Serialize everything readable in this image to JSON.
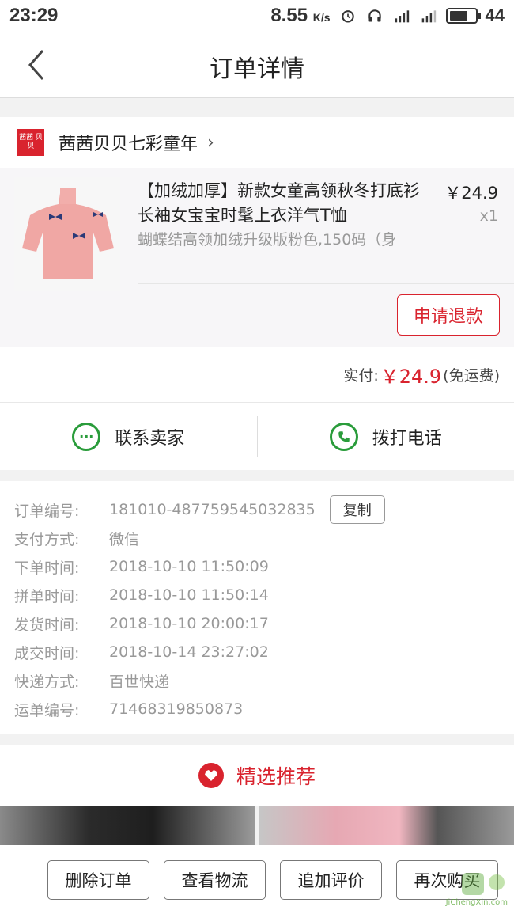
{
  "status": {
    "time": "23:29",
    "speed": "8.55",
    "speed_unit": "K/s",
    "net1": "3G",
    "net2": "4G",
    "battery": "44"
  },
  "nav": {
    "title": "订单详情"
  },
  "shop": {
    "logo_text": "茜茜 贝贝",
    "name": "茜茜贝贝七彩童年"
  },
  "product": {
    "title": "【加绒加厚】新款女童高领秋冬打底衫长袖女宝宝时髦上衣洋气T恤",
    "spec": "蝴蝶结高领加绒升级版粉色,150码（身",
    "price": "￥24.9",
    "qty": "x1",
    "refund_label": "申请退款"
  },
  "payment": {
    "label": "实付:",
    "amount": "￥24.9",
    "note": "(免运费)"
  },
  "contact": {
    "seller_label": "联系卖家",
    "call_label": "拨打电话"
  },
  "order_info": {
    "rows": [
      {
        "key": "订单编号:",
        "value": "181010-487759545032835"
      },
      {
        "key": "支付方式:",
        "value": "微信"
      },
      {
        "key": "下单时间:",
        "value": "2018-10-10 11:50:09"
      },
      {
        "key": "拼单时间:",
        "value": "2018-10-10 11:50:14"
      },
      {
        "key": "发货时间:",
        "value": "2018-10-10 20:00:17"
      },
      {
        "key": "成交时间:",
        "value": "2018-10-14 23:27:02"
      },
      {
        "key": "快递方式:",
        "value": "百世快递"
      },
      {
        "key": "运单编号:",
        "value": "71468319850873"
      }
    ],
    "copy_label": "复制"
  },
  "recommend": {
    "title": "精选推荐"
  },
  "actions": {
    "delete": "删除订单",
    "logistics": "查看物流",
    "review": "追加评价",
    "rebuy": "再次购买"
  },
  "watermark": {
    "text": "JiChengXin.com"
  },
  "colors": {
    "accent": "#d9232e",
    "green": "#2a9c3b"
  }
}
